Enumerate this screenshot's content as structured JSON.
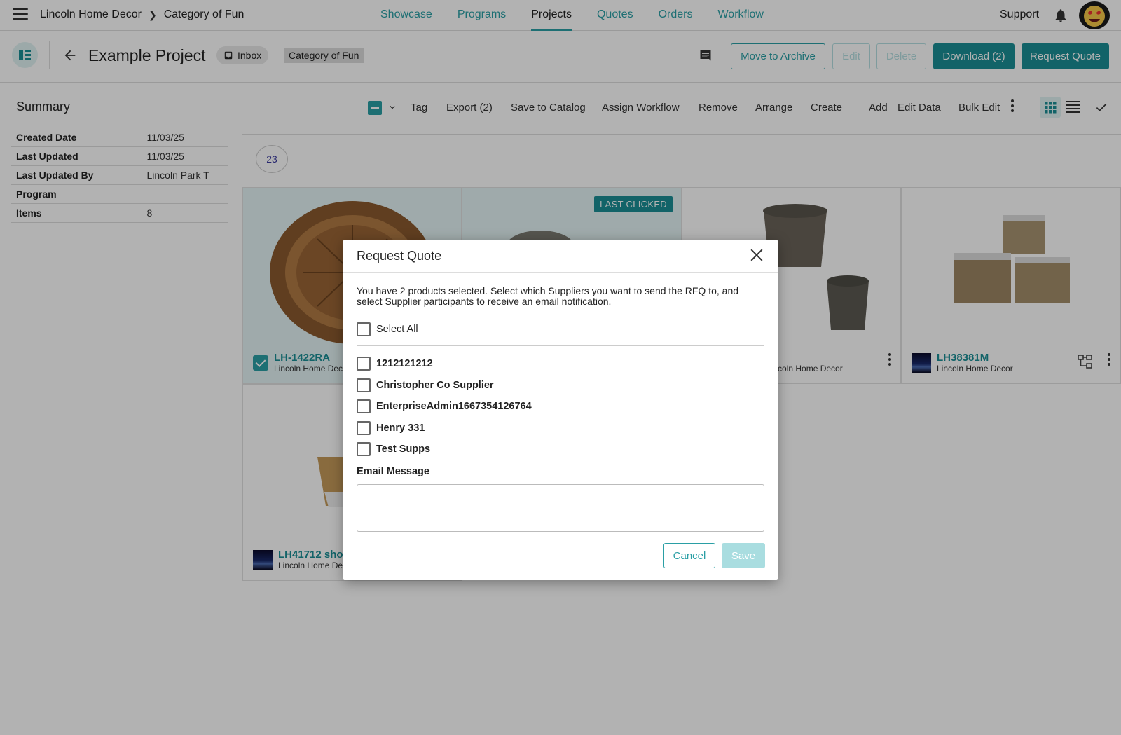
{
  "nav": {
    "breadcrumb": [
      "Lincoln Home Decor",
      "Category of Fun"
    ],
    "tabs": [
      {
        "label": "Showcase"
      },
      {
        "label": "Programs"
      },
      {
        "label": "Projects"
      },
      {
        "label": "Quotes"
      },
      {
        "label": "Orders"
      },
      {
        "label": "Workflow"
      }
    ],
    "active_tab": "Projects",
    "support_label": "Support"
  },
  "project": {
    "title": "Example Project",
    "inbox_label": "Inbox",
    "category_chip": "Category of Fun",
    "buttons": {
      "archive": "Move to Archive",
      "edit": "Edit",
      "delete": "Delete",
      "download": "Download (2)",
      "request_quote": "Request Quote"
    }
  },
  "summary": {
    "title": "Summary",
    "rows": [
      {
        "key": "Created Date",
        "value": "11/03/25"
      },
      {
        "key": "Last Updated",
        "value": "11/03/25"
      },
      {
        "key": "Last Updated By",
        "value": "Lincoln Park T"
      },
      {
        "key": "Program",
        "value": ""
      },
      {
        "key": "Items",
        "value": "8"
      }
    ]
  },
  "toolbar": {
    "items": [
      "Tag",
      "Export (2)",
      "Save to Catalog",
      "Assign Workflow",
      "Remove",
      "Arrange",
      "Create",
      "Add",
      "Edit Data",
      "Bulk Edit"
    ]
  },
  "item_count": "23",
  "cards": [
    {
      "sku": "LH-1422RA",
      "company": "Lincoln Home Decor",
      "selected": true
    },
    {
      "sku": "",
      "company": "",
      "badge": "LAST CLICKED",
      "selected": true
    },
    {
      "sku": "",
      "company": "Lincoln Home Decor",
      "selected": false
    },
    {
      "sku": "LH38381M",
      "company": "Lincoln Home Decor",
      "selected": false
    },
    {
      "sku": "LH41712 shop",
      "company": "Lincoln Home Decor",
      "selected": false
    }
  ],
  "modal": {
    "title": "Request Quote",
    "description": "You have 2 products selected. Select which Suppliers you want to send the RFQ to, and select Supplier participants to receive an email notification.",
    "select_all": "Select All",
    "suppliers": [
      "1212121212",
      "Christopher Co Supplier",
      "EnterpriseAdmin1667354126764",
      "Henry 331",
      "Test Supps"
    ],
    "email_label": "Email Message",
    "email_value": "",
    "cancel": "Cancel",
    "save": "Save"
  },
  "colors": {
    "accent": "#2a9fa5",
    "accent_dark": "#1b8f95",
    "disabled": "#a9dde0"
  }
}
